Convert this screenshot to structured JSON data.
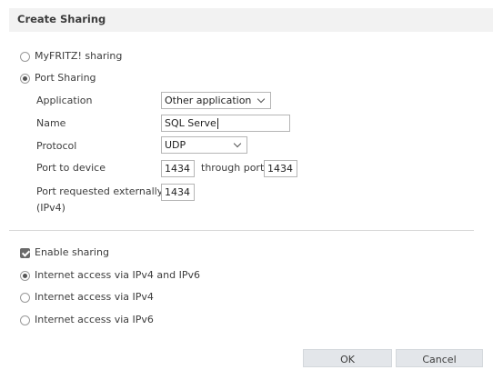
{
  "dialog": {
    "title": "Create Sharing"
  },
  "sharing_type": {
    "myfritz_label": "MyFRITZ! sharing",
    "port_label": "Port Sharing"
  },
  "form": {
    "application_label": "Application",
    "application_value": "Other application",
    "name_label": "Name",
    "name_value": "SQL Serve",
    "protocol_label": "Protocol",
    "protocol_value": "UDP",
    "port_to_device_label": "Port to device",
    "port_to_device_value": "1434",
    "through_port_label": "through port",
    "through_port_value": "1434",
    "port_external_label_line1": "Port requested externally",
    "port_external_label_line2": "(IPv4)",
    "port_external_value": "1434"
  },
  "options": {
    "enable_sharing_label": "Enable sharing",
    "ipv4_ipv6_label": "Internet access via IPv4 and IPv6",
    "ipv4_label": "Internet access via IPv4",
    "ipv6_label": "Internet access via IPv6"
  },
  "buttons": {
    "ok_label": "OK",
    "cancel_label": "Cancel"
  },
  "colors": {
    "header_bg": "#f2f2f2",
    "button_bg": "#e3e6ea",
    "text": "#3c3c3c"
  }
}
